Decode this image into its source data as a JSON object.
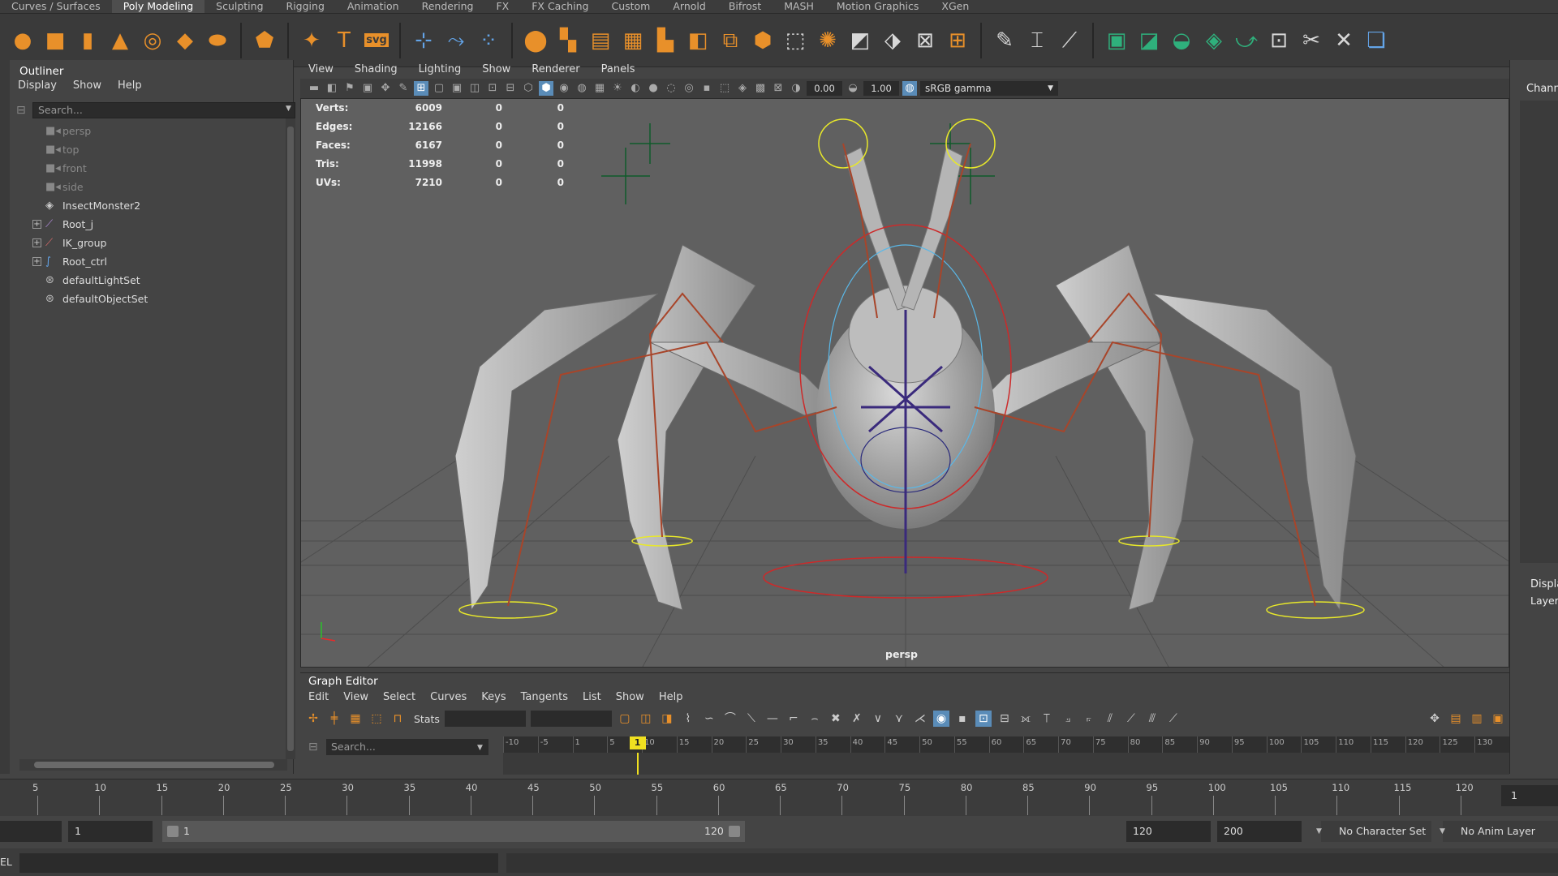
{
  "shelf": {
    "tabs": [
      "Curves / Surfaces",
      "Poly Modeling",
      "Sculpting",
      "Rigging",
      "Animation",
      "Rendering",
      "FX",
      "FX Caching",
      "Custom",
      "Arnold",
      "Bifrost",
      "MASH",
      "Motion Graphics",
      "XGen"
    ],
    "active_tab": "Poly Modeling",
    "svg_icon_text": "svg"
  },
  "outliner": {
    "title": "Outliner",
    "menu": [
      "Display",
      "Show",
      "Help"
    ],
    "search_placeholder": "Search...",
    "items": [
      {
        "label": "persp",
        "icon": "camera-icon",
        "dim": true,
        "expandable": false
      },
      {
        "label": "top",
        "icon": "camera-icon",
        "dim": true,
        "expandable": false
      },
      {
        "label": "front",
        "icon": "camera-icon",
        "dim": true,
        "expandable": false
      },
      {
        "label": "side",
        "icon": "camera-icon",
        "dim": true,
        "expandable": false
      },
      {
        "label": "InsectMonster2",
        "icon": "mesh-icon",
        "dim": false,
        "expandable": false
      },
      {
        "label": "Root_j",
        "icon": "joint-icon",
        "dim": false,
        "expandable": true
      },
      {
        "label": "IK_group",
        "icon": "ik-handle-icon",
        "dim": false,
        "expandable": true
      },
      {
        "label": "Root_ctrl",
        "icon": "curve-icon",
        "dim": false,
        "expandable": true
      },
      {
        "label": "defaultLightSet",
        "icon": "set-icon",
        "dim": false,
        "expandable": false
      },
      {
        "label": "defaultObjectSet",
        "icon": "set-icon",
        "dim": false,
        "expandable": false
      }
    ]
  },
  "viewport": {
    "menu": [
      "View",
      "Shading",
      "Lighting",
      "Show",
      "Renderer",
      "Panels"
    ],
    "exposure": "0.00",
    "gamma": "1.00",
    "color_space": "sRGB gamma",
    "camera": "persp",
    "hud": [
      {
        "label": "Verts:",
        "v1": "6009",
        "v2": "0",
        "v3": "0"
      },
      {
        "label": "Edges:",
        "v1": "12166",
        "v2": "0",
        "v3": "0"
      },
      {
        "label": "Faces:",
        "v1": "6167",
        "v2": "0",
        "v3": "0"
      },
      {
        "label": "Tris:",
        "v1": "11998",
        "v2": "0",
        "v3": "0"
      },
      {
        "label": "UVs:",
        "v1": "7210",
        "v2": "0",
        "v3": "0"
      }
    ]
  },
  "right_panel": {
    "channel_box_label": "Chann",
    "display_label": "Displa",
    "layers_label": "Layers"
  },
  "graph_editor": {
    "title": "Graph Editor",
    "menu": [
      "Edit",
      "View",
      "Select",
      "Curves",
      "Keys",
      "Tangents",
      "List",
      "Show",
      "Help"
    ],
    "stats_label": "Stats",
    "search_placeholder": "Search...",
    "ruler_ticks": [
      "-10",
      "-5",
      "1",
      "5",
      "10",
      "15",
      "20",
      "25",
      "30",
      "35",
      "40",
      "45",
      "50",
      "55",
      "60",
      "65",
      "70",
      "75",
      "80",
      "85",
      "90",
      "95",
      "100",
      "105",
      "110",
      "115",
      "120",
      "125",
      "130"
    ],
    "current_frame": "1"
  },
  "timeline": {
    "ticks": [
      "5",
      "10",
      "15",
      "20",
      "25",
      "30",
      "35",
      "40",
      "45",
      "50",
      "55",
      "60",
      "65",
      "70",
      "75",
      "80",
      "85",
      "90",
      "95",
      "100",
      "105",
      "110",
      "115",
      "120"
    ],
    "current_frame_field": "1"
  },
  "range": {
    "start_field": "1",
    "range_start": "1",
    "range_end": "120",
    "end_field": "120",
    "max_field": "200",
    "character_set": "No Character Set",
    "anim_layer": "No Anim Layer"
  },
  "status": {
    "mode_label": "EL"
  },
  "colors": {
    "highlight_blue": "#5a8cb8",
    "playhead_yellow": "#f0e020",
    "shelf_orange": "#e8902a",
    "shelf_green": "#2fb07c"
  }
}
